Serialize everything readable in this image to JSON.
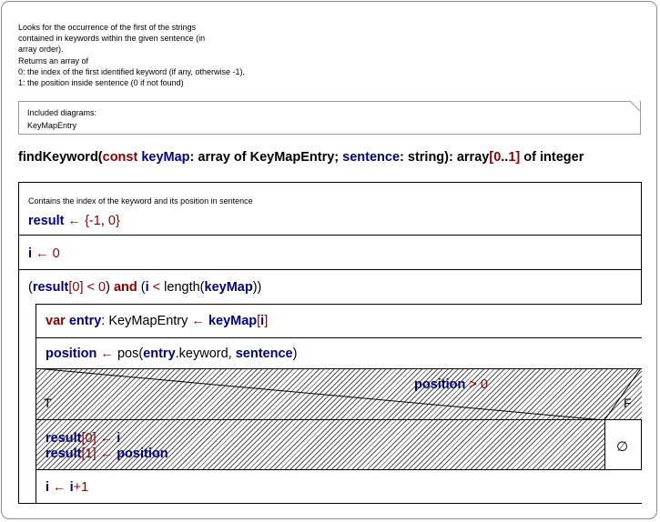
{
  "comment": {
    "lines": [
      "Looks for the occurrence of the first of the strings",
      "contained in keywords within the given sentence (in",
      "array order).",
      "Returns an array of",
      "0: the index of the first identified keyword (if any, otherwise -1),",
      "1: the position inside sentence (0 if not found)"
    ]
  },
  "diagrams": {
    "title": "Included diagrams:",
    "item": "KeyMapEntry"
  },
  "signature": {
    "name": "findKeyword(",
    "const": "const",
    "p1": "keyMap",
    "p1_type": ": array of KeyMapEntry; ",
    "p2": "sentence",
    "p2_type": ": string): array",
    "range_open": "[",
    "range_lo": "0",
    "range_dots": "..",
    "range_hi": "1",
    "range_close": "]",
    "ret": " of integer"
  },
  "init": {
    "comment": "Contains the index of the keyword and its position in sentence",
    "var": "result",
    "arrow": " ← ",
    "brace_open": "{",
    "minus": "-",
    "v1": "1",
    "comma": ", ",
    "v2": "0",
    "brace_close": "}"
  },
  "assign_i": {
    "var": "i",
    "arrow": " ← ",
    "val": "0"
  },
  "loop": {
    "p_open": "(",
    "result": "result",
    "idx_open": "[",
    "idx": "0",
    "idx_close": "]",
    "lt": " < ",
    "zero": "0",
    "p_close": ") ",
    "and": "and",
    "p2_open": " (",
    "i": "i",
    "lt2": " < ",
    "len": "length(",
    "keyMap": "keyMap",
    "end": "))"
  },
  "decl": {
    "var_kw": "var",
    "entry": "entry",
    "type": ": KeyMapEntry",
    "arrow": " ← ",
    "keyMap": "keyMap",
    "b_open": "[",
    "i": "i",
    "b_close": "]"
  },
  "pos": {
    "position": "position",
    "arrow": " ← ",
    "fn": "pos(",
    "entry": "entry",
    "field": ".keyword, ",
    "sentence": "sentence",
    "close": ")"
  },
  "cond": {
    "position": "position",
    "gt": " > ",
    "zero": "0",
    "true_label": "T",
    "false_label": "F"
  },
  "then": {
    "l1_var": "result",
    "l1_open": "[",
    "l1_idx": "0",
    "l1_close": "]",
    "l1_arrow": " ← ",
    "l1_val": "i",
    "l2_var": "result",
    "l2_open": "[",
    "l2_idx": "1",
    "l2_close": "]",
    "l2_arrow": " ← ",
    "l2_val": "position"
  },
  "else_symbol": "∅",
  "incr": {
    "var": "i",
    "arrow": " ← ",
    "i": "i",
    "plus": "+",
    "one": "1"
  }
}
